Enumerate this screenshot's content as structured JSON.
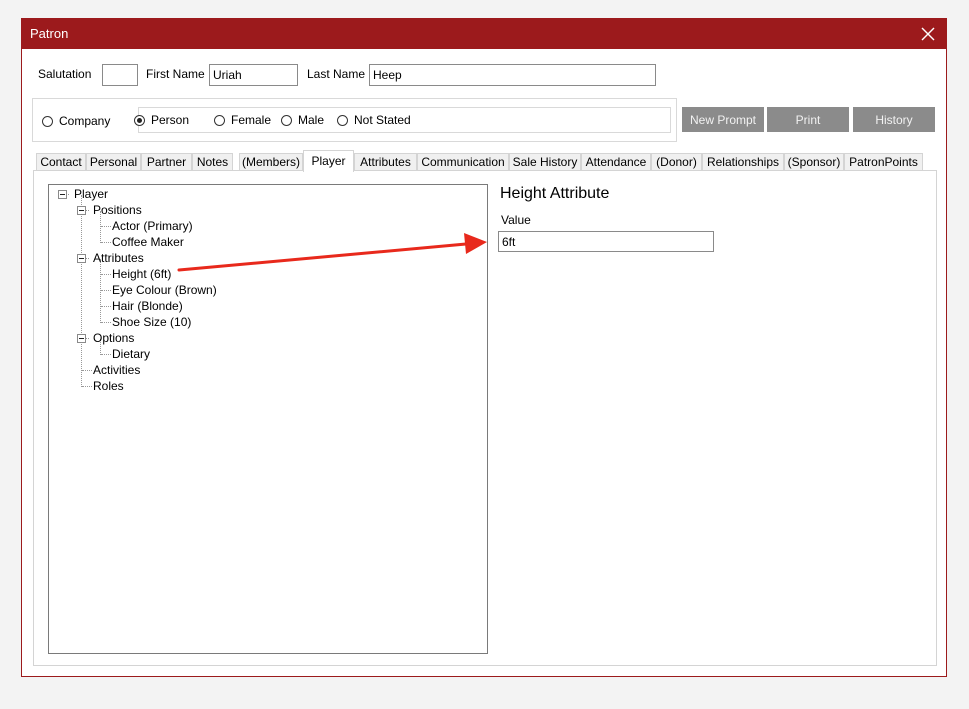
{
  "window": {
    "title": "Patron"
  },
  "name_fields": {
    "salutation_label": "Salutation",
    "salutation_value": "",
    "first_name_label": "First Name",
    "first_name_value": "Uriah",
    "last_name_label": "Last Name",
    "last_name_value": "Heep"
  },
  "type_radios": {
    "company": "Company",
    "person": "Person",
    "selected": "Person"
  },
  "gender_radios": {
    "female": "Female",
    "male": "Male",
    "not_stated": "Not Stated"
  },
  "buttons": {
    "new_prompt": "New Prompt",
    "print": "Print",
    "history": "History"
  },
  "tabs": [
    "Contact",
    "Personal",
    "Partner",
    "Notes",
    "(Members)",
    "Player",
    "Attributes",
    "Communication",
    "Sale History",
    "Attendance",
    "(Donor)",
    "Relationships",
    "(Sponsor)",
    "PatronPoints"
  ],
  "active_tab": "Player",
  "tree": {
    "root": "Player",
    "positions": {
      "label": "Positions",
      "items": [
        "Actor (Primary)",
        "Coffee Maker"
      ]
    },
    "attributes": {
      "label": "Attributes",
      "items": [
        "Height (6ft)",
        "Eye Colour (Brown)",
        "Hair (Blonde)",
        "Shoe Size (10)"
      ]
    },
    "options": {
      "label": "Options",
      "items": [
        "Dietary"
      ]
    },
    "activities": "Activities",
    "roles": "Roles"
  },
  "detail": {
    "heading": "Height Attribute",
    "value_label": "Value",
    "value": "6ft"
  },
  "colors": {
    "titlebar": "#9c1a1c",
    "button_bg": "#8b8b8b",
    "arrow": "#e8291c"
  }
}
